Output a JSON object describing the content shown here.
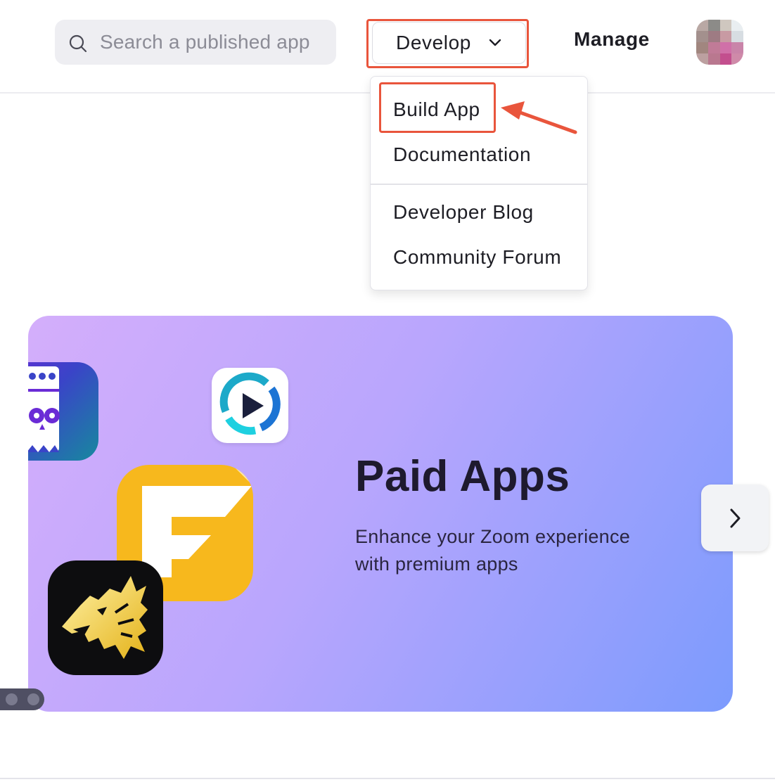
{
  "header": {
    "search": {
      "placeholder": "Search a published app",
      "icon": "search-icon"
    },
    "develop_label": "Develop",
    "manage_label": "Manage",
    "avatar_colors": [
      "#b9a8a4",
      "#8c8b88",
      "#cfc7bf",
      "#e9eef1",
      "#a3908d",
      "#9e7b83",
      "#c89aa3",
      "#d7dde2",
      "#a1867f",
      "#c07b97",
      "#d070a8",
      "#c984a9",
      "#bca0a0",
      "#b9788f",
      "#c34f8e",
      "#cf8aa9"
    ]
  },
  "develop_menu": {
    "items": [
      "Build App",
      "Documentation",
      "Developer Blog",
      "Community Forum"
    ],
    "highlighted_item": "Build App"
  },
  "annotation": {
    "color": "#e9553c"
  },
  "banner": {
    "title": "Paid Apps",
    "subtitle": "Enhance your Zoom experience with premium apps",
    "icons": [
      "owl-app-icon",
      "video-play-app-icon",
      "f-letter-app-icon",
      "wolf-app-icon"
    ]
  },
  "carousel": {
    "next_icon": "chevron-right-icon",
    "dot_count": 2
  }
}
